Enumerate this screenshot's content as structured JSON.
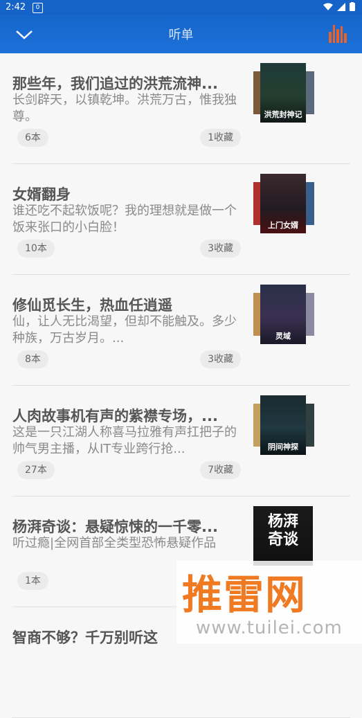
{
  "status": {
    "time": "2:42",
    "sim": "0"
  },
  "header": {
    "title": "听单"
  },
  "lists": [
    {
      "title": "那些年，我们追过的洪荒流神...",
      "desc": "长剑辟天，以镇乾坤。洪荒万古，惟我独尊。",
      "count": "6本",
      "fav": "1收藏",
      "cover_text": "洪荒封神记"
    },
    {
      "title": "女婿翻身",
      "desc": "谁还吃不起软饭呢？我的理想就是做一个饭来张口的小白脸！",
      "count": "10本",
      "fav": "3收藏",
      "cover_text": "上门女婿"
    },
    {
      "title": "修仙觅长生，热血任逍遥",
      "desc": "仙，让人无比渴望，但却不能触及。多少种族，万古岁月。...",
      "count": "8本",
      "fav": "3收藏",
      "cover_text": "灵域"
    },
    {
      "title": "人肉故事机有声的紫襟专场，...",
      "desc": "这是一只江湖人称喜马拉雅有声扛把子的帅气男主播，从IT专业跨行抢...",
      "count": "27本",
      "fav": "7收藏",
      "cover_text": "阴间神探"
    },
    {
      "title": "杨湃奇谈：悬疑惊悚的一千零...",
      "desc": "听过瘾|全网首部全类型恐怖悬疑作品",
      "count": "1本",
      "fav": "",
      "cover_text": "杨湃奇谈"
    },
    {
      "title": "智商不够？千万别听这",
      "desc": "",
      "count": "",
      "fav": "",
      "cover_text": ""
    }
  ],
  "watermark": {
    "brand": "推雷网",
    "url": "www.tuilei.com"
  },
  "colors": {
    "appbar": "#1766cc",
    "accent": "#e8632b"
  }
}
